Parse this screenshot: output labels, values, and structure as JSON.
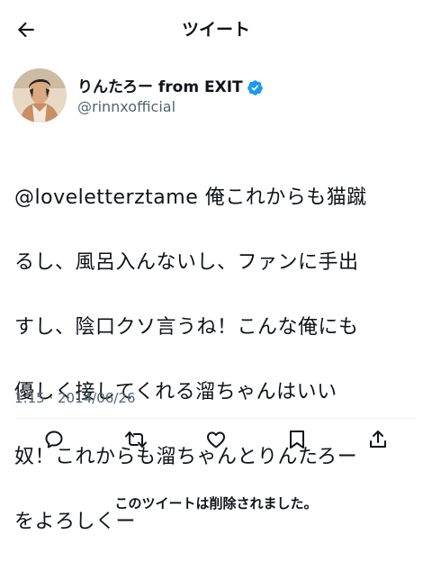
{
  "header": {
    "title": "ツイート",
    "back_icon": "arrow-left-icon"
  },
  "author": {
    "display_name": "りんたろー from EXIT",
    "handle": "@rinnxofficial",
    "verified": true,
    "verified_color": "#1d9bf0",
    "avatar": "avatar-photo"
  },
  "tweet": {
    "text_lines": [
      "@loveletterztame 俺これからも猫蹴",
      "るし、風呂入んないし、ファンに手出",
      "すし、陰口クソ言うね！こんな俺にも",
      "優しく接してくれる溜ちゃんはいい",
      "奴！これからも溜ちゃんとりんたろー",
      "をよろしくー"
    ],
    "timestamp": "1:15 · 2014/06/26"
  },
  "actions": {
    "icons": [
      "reply-icon",
      "retweet-icon",
      "like-icon",
      "bookmark-icon",
      "share-icon"
    ]
  },
  "footer": {
    "deleted_note": "このツイートは削除されました。"
  },
  "colors": {
    "text": "#0f1419",
    "secondary": "#536471",
    "divider": "#eff3f4"
  }
}
